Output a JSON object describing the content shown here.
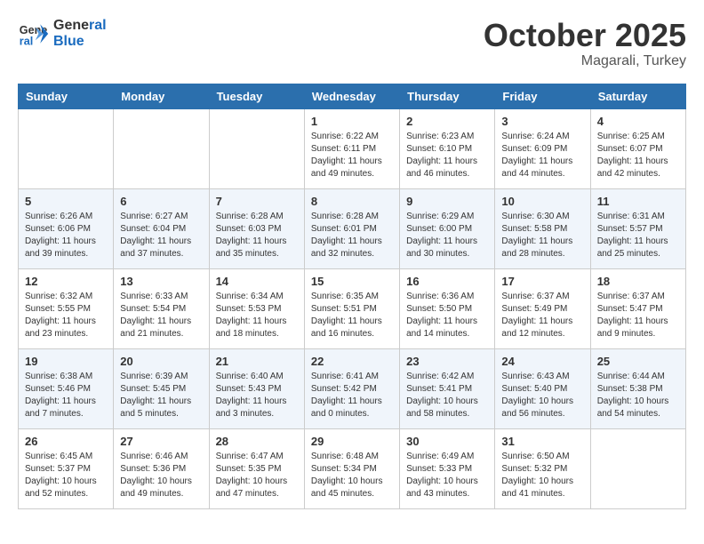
{
  "header": {
    "logo_line1": "General",
    "logo_line2": "Blue",
    "month": "October 2025",
    "location": "Magarali, Turkey"
  },
  "weekdays": [
    "Sunday",
    "Monday",
    "Tuesday",
    "Wednesday",
    "Thursday",
    "Friday",
    "Saturday"
  ],
  "weeks": [
    [
      {
        "day": "",
        "info": ""
      },
      {
        "day": "",
        "info": ""
      },
      {
        "day": "",
        "info": ""
      },
      {
        "day": "1",
        "info": "Sunrise: 6:22 AM\nSunset: 6:11 PM\nDaylight: 11 hours\nand 49 minutes."
      },
      {
        "day": "2",
        "info": "Sunrise: 6:23 AM\nSunset: 6:10 PM\nDaylight: 11 hours\nand 46 minutes."
      },
      {
        "day": "3",
        "info": "Sunrise: 6:24 AM\nSunset: 6:09 PM\nDaylight: 11 hours\nand 44 minutes."
      },
      {
        "day": "4",
        "info": "Sunrise: 6:25 AM\nSunset: 6:07 PM\nDaylight: 11 hours\nand 42 minutes."
      }
    ],
    [
      {
        "day": "5",
        "info": "Sunrise: 6:26 AM\nSunset: 6:06 PM\nDaylight: 11 hours\nand 39 minutes."
      },
      {
        "day": "6",
        "info": "Sunrise: 6:27 AM\nSunset: 6:04 PM\nDaylight: 11 hours\nand 37 minutes."
      },
      {
        "day": "7",
        "info": "Sunrise: 6:28 AM\nSunset: 6:03 PM\nDaylight: 11 hours\nand 35 minutes."
      },
      {
        "day": "8",
        "info": "Sunrise: 6:28 AM\nSunset: 6:01 PM\nDaylight: 11 hours\nand 32 minutes."
      },
      {
        "day": "9",
        "info": "Sunrise: 6:29 AM\nSunset: 6:00 PM\nDaylight: 11 hours\nand 30 minutes."
      },
      {
        "day": "10",
        "info": "Sunrise: 6:30 AM\nSunset: 5:58 PM\nDaylight: 11 hours\nand 28 minutes."
      },
      {
        "day": "11",
        "info": "Sunrise: 6:31 AM\nSunset: 5:57 PM\nDaylight: 11 hours\nand 25 minutes."
      }
    ],
    [
      {
        "day": "12",
        "info": "Sunrise: 6:32 AM\nSunset: 5:55 PM\nDaylight: 11 hours\nand 23 minutes."
      },
      {
        "day": "13",
        "info": "Sunrise: 6:33 AM\nSunset: 5:54 PM\nDaylight: 11 hours\nand 21 minutes."
      },
      {
        "day": "14",
        "info": "Sunrise: 6:34 AM\nSunset: 5:53 PM\nDaylight: 11 hours\nand 18 minutes."
      },
      {
        "day": "15",
        "info": "Sunrise: 6:35 AM\nSunset: 5:51 PM\nDaylight: 11 hours\nand 16 minutes."
      },
      {
        "day": "16",
        "info": "Sunrise: 6:36 AM\nSunset: 5:50 PM\nDaylight: 11 hours\nand 14 minutes."
      },
      {
        "day": "17",
        "info": "Sunrise: 6:37 AM\nSunset: 5:49 PM\nDaylight: 11 hours\nand 12 minutes."
      },
      {
        "day": "18",
        "info": "Sunrise: 6:37 AM\nSunset: 5:47 PM\nDaylight: 11 hours\nand 9 minutes."
      }
    ],
    [
      {
        "day": "19",
        "info": "Sunrise: 6:38 AM\nSunset: 5:46 PM\nDaylight: 11 hours\nand 7 minutes."
      },
      {
        "day": "20",
        "info": "Sunrise: 6:39 AM\nSunset: 5:45 PM\nDaylight: 11 hours\nand 5 minutes."
      },
      {
        "day": "21",
        "info": "Sunrise: 6:40 AM\nSunset: 5:43 PM\nDaylight: 11 hours\nand 3 minutes."
      },
      {
        "day": "22",
        "info": "Sunrise: 6:41 AM\nSunset: 5:42 PM\nDaylight: 11 hours\nand 0 minutes."
      },
      {
        "day": "23",
        "info": "Sunrise: 6:42 AM\nSunset: 5:41 PM\nDaylight: 10 hours\nand 58 minutes."
      },
      {
        "day": "24",
        "info": "Sunrise: 6:43 AM\nSunset: 5:40 PM\nDaylight: 10 hours\nand 56 minutes."
      },
      {
        "day": "25",
        "info": "Sunrise: 6:44 AM\nSunset: 5:38 PM\nDaylight: 10 hours\nand 54 minutes."
      }
    ],
    [
      {
        "day": "26",
        "info": "Sunrise: 6:45 AM\nSunset: 5:37 PM\nDaylight: 10 hours\nand 52 minutes."
      },
      {
        "day": "27",
        "info": "Sunrise: 6:46 AM\nSunset: 5:36 PM\nDaylight: 10 hours\nand 49 minutes."
      },
      {
        "day": "28",
        "info": "Sunrise: 6:47 AM\nSunset: 5:35 PM\nDaylight: 10 hours\nand 47 minutes."
      },
      {
        "day": "29",
        "info": "Sunrise: 6:48 AM\nSunset: 5:34 PM\nDaylight: 10 hours\nand 45 minutes."
      },
      {
        "day": "30",
        "info": "Sunrise: 6:49 AM\nSunset: 5:33 PM\nDaylight: 10 hours\nand 43 minutes."
      },
      {
        "day": "31",
        "info": "Sunrise: 6:50 AM\nSunset: 5:32 PM\nDaylight: 10 hours\nand 41 minutes."
      },
      {
        "day": "",
        "info": ""
      }
    ]
  ]
}
